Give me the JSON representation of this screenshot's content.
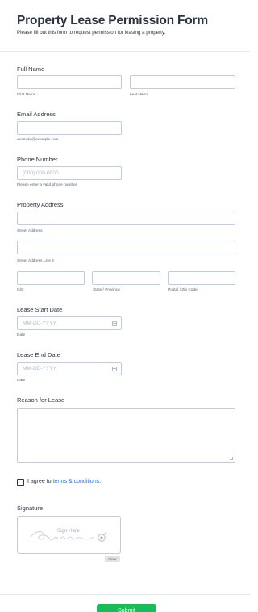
{
  "header": {
    "title": "Property Lease Permission Form",
    "subtitle": "Please fill out this form to request permission for leasing a property."
  },
  "full_name": {
    "label": "Full Name",
    "first_sub": "First Name",
    "last_sub": "Last Name"
  },
  "email": {
    "label": "Email Address",
    "sub": "example@example.com"
  },
  "phone": {
    "label": "Phone Number",
    "placeholder": "(000) 000-0000",
    "sub": "Please enter a valid phone number."
  },
  "address": {
    "label": "Property Address",
    "street_sub": "Street Address",
    "street2_sub": "Street Address Line 2",
    "city_sub": "City",
    "state_sub": "State / Province",
    "zip_sub": "Postal / Zip Code"
  },
  "lease_start": {
    "label": "Lease Start Date",
    "placeholder": "MM-DD-YYYY",
    "sub": "Date"
  },
  "lease_end": {
    "label": "Lease End Date",
    "placeholder": "MM-DD-YYYY",
    "sub": "Date"
  },
  "reason": {
    "label": "Reason for Lease"
  },
  "terms": {
    "prefix": "I agree to ",
    "link": "terms & conditions",
    "suffix": "."
  },
  "signature": {
    "label": "Signature",
    "hint": "Sign Here",
    "clear_label": "Clear"
  },
  "submit": {
    "label": "Submit"
  },
  "colors": {
    "accent": "#18bd5b",
    "link": "#2e69ff",
    "text": "#2c3345",
    "border": "#c3cad8"
  }
}
